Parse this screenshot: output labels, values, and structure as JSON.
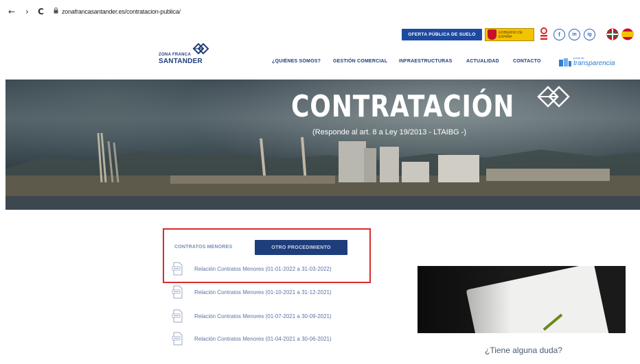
{
  "browser": {
    "back": "←",
    "forward": "›",
    "reload": "C",
    "url": "zonafrancasantander.es/contratacion-publica/"
  },
  "header": {
    "logo_small": "ZONA FRANCA",
    "logo_big": "SANTANDER",
    "oferta_button": "OFERTA PÚBLICA DE SUELO",
    "gov_badge_text": "GOBIERNO DE ESPAÑA",
    "social": [
      "f",
      "in",
      "ig"
    ],
    "nav": [
      "¿QUIÉNES SOMOS?",
      "GESTIÓN COMERCIAL",
      "INFRAESTRUCTURAS",
      "ACTUALIDAD",
      "CONTACTO"
    ],
    "transparency_label": "transparencia",
    "transparency_small": "portal de"
  },
  "hero": {
    "title": "CONTRATACIÓN",
    "subtitle": "(Responde al art. 8 a Ley 19/2013 - LTAIBG -)"
  },
  "tabs": {
    "active": "CONTRATOS MENORES",
    "other": "OTRO PROCEDIMIENTO"
  },
  "documents": [
    "Relación Contratos Menores (01-01-2022 a 31-03-2022)",
    "Relación Contratos Menores (01-10-2021 a 31-12-2021)",
    "Relación Contratos Menores (01-07-2021 a 30-09-2021)",
    "Relación Contratos Menores (01-04-2021 a 30-06-2021)"
  ],
  "sidebar": {
    "question": "¿Tiene alguna duda?"
  },
  "colors": {
    "brand_blue": "#1e3d7b",
    "button_blue": "#1d4aa0",
    "highlight_red": "#d52b2b"
  }
}
